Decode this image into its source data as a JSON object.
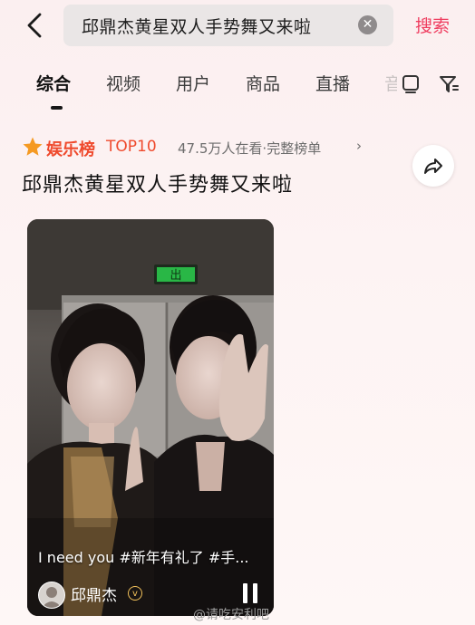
{
  "header": {
    "search_query": "邱鼎杰黄星双人手势舞又来啦",
    "search_button": "搜索"
  },
  "tabs": [
    {
      "label": "综合",
      "active": true
    },
    {
      "label": "视频"
    },
    {
      "label": "用户"
    },
    {
      "label": "商品"
    },
    {
      "label": "直播"
    },
    {
      "label": "音"
    }
  ],
  "leaderboard": {
    "name": "娱乐榜",
    "rank": "TOP10",
    "watching": "47.5万人在看",
    "full_list": "完整榜单",
    "separator": "·"
  },
  "result": {
    "title": "邱鼎杰黄星双人手势舞又来啦"
  },
  "video": {
    "caption": "I need you #新年有礼了 #手...",
    "author": "邱鼎杰",
    "exit_sign": "出"
  },
  "watermark": "@请吃安利吧",
  "colors": {
    "accent": "#ef3d5f",
    "leaderboard": "#ef4a2d",
    "background": "#fbeff0"
  }
}
